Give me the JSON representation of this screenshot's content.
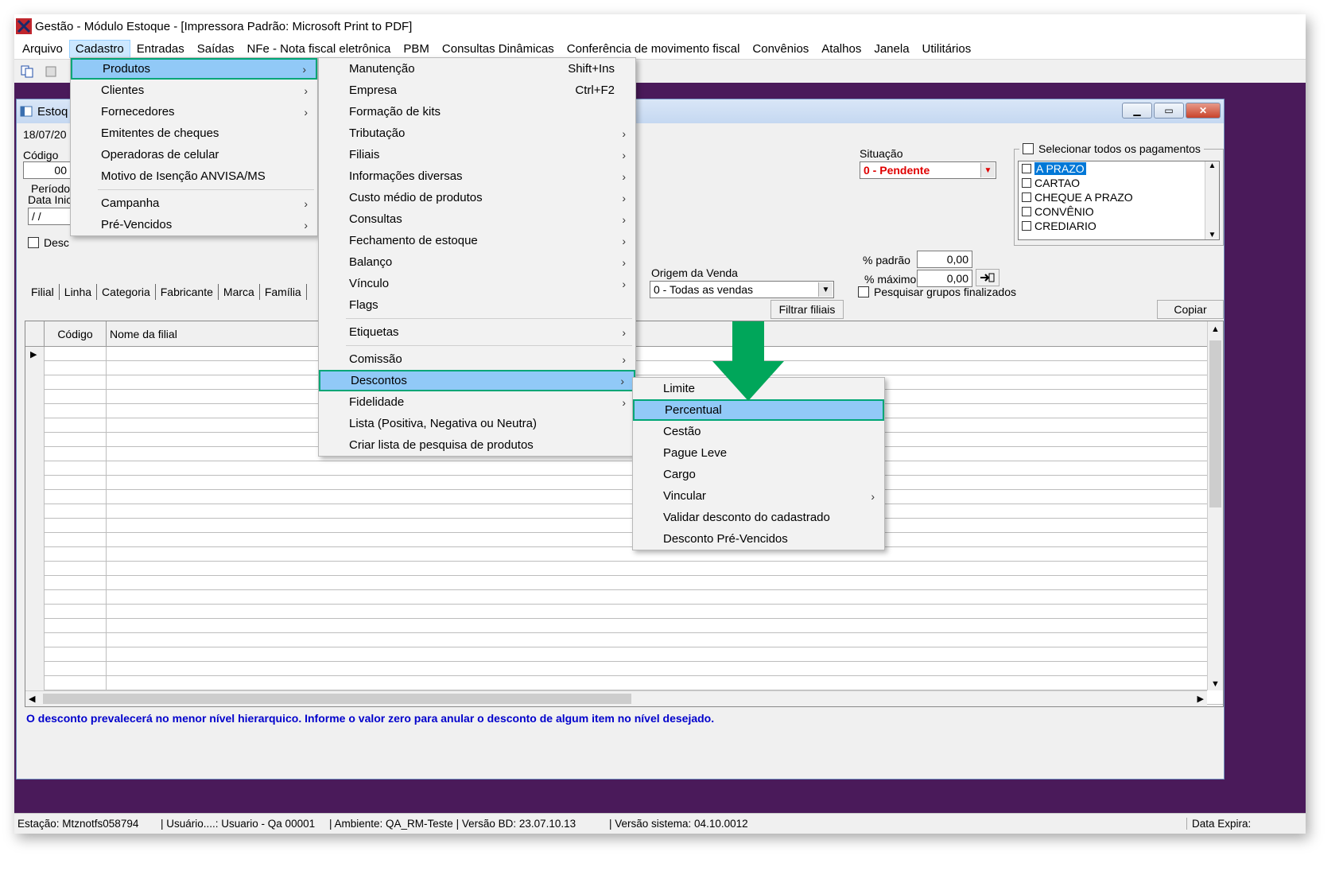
{
  "app": {
    "title": "Gestão  - Módulo Estoque - [Impressora Padrão: Microsoft Print to PDF]"
  },
  "menubar": [
    "Arquivo",
    "Cadastro",
    "Entradas",
    "Saídas",
    "NFe - Nota fiscal eletrônica",
    "PBM",
    "Consultas Dinâmicas",
    "Conferência de movimento fiscal",
    "Convênios",
    "Atalhos",
    "Janela",
    "Utilitários"
  ],
  "child": {
    "title": "Estoq",
    "date": "18/07/20",
    "codigo_label": "Código",
    "codigo_value": "00",
    "periodo_label": "Período",
    "data_inicio_label": "Data Inic",
    "data_inicio_value": "/ /",
    "desc_label": "Desc",
    "situacao_label": "Situação",
    "situacao_value": "0 - Pendente",
    "select_all_label": "Selecionar todos os pagamentos",
    "payments": [
      "A PRAZO",
      "CARTAO",
      "CHEQUE A PRAZO",
      "CONVÊNIO",
      "CREDIARIO"
    ],
    "pct_padrao_label": "% padrão",
    "pct_padrao_value": "0,00",
    "pct_maximo_label": "% máximo",
    "pct_maximo_value": "0,00",
    "origem_label": "Origem da Venda",
    "origem_value": "0 - Todas as vendas",
    "grupos_label": "Pesquisar grupos finalizados",
    "tabs": [
      "Filial",
      "Linha",
      "Categoria",
      "Fabricante",
      "Marca",
      "Família"
    ],
    "filtrar_label": "Filtrar filiais",
    "copiar_label": "Copiar",
    "grid_headers": [
      "Código",
      "Nome da filial"
    ],
    "hint": "O desconto prevalecerá no menor nível hierarquico. Informe o valor zero para anular o desconto de algum item no nível desejado."
  },
  "menu_cadastro": [
    {
      "label": "Produtos",
      "arrow": true,
      "highlight": true
    },
    {
      "label": "Clientes",
      "arrow": true
    },
    {
      "label": "Fornecedores",
      "arrow": true
    },
    {
      "label": "Emitentes de cheques"
    },
    {
      "label": "Operadoras de celular"
    },
    {
      "label": "Motivo de Isenção ANVISA/MS"
    },
    {
      "separator": true
    },
    {
      "label": "Campanha",
      "arrow": true
    },
    {
      "label": "Pré-Vencidos",
      "arrow": true
    }
  ],
  "menu_produtos": [
    {
      "label": "Manutenção",
      "shortcut": "Shift+Ins"
    },
    {
      "label": "Empresa",
      "shortcut": "Ctrl+F2"
    },
    {
      "label": "Formação de kits"
    },
    {
      "label": "Tributação",
      "arrow": true
    },
    {
      "label": "Filiais",
      "arrow": true
    },
    {
      "label": "Informações diversas",
      "arrow": true
    },
    {
      "label": "Custo médio de produtos",
      "arrow": true
    },
    {
      "label": "Consultas",
      "arrow": true
    },
    {
      "label": "Fechamento de estoque",
      "arrow": true
    },
    {
      "label": "Balanço",
      "arrow": true
    },
    {
      "label": "Vínculo",
      "arrow": true
    },
    {
      "label": "Flags"
    },
    {
      "separator": true
    },
    {
      "label": "Etiquetas",
      "arrow": true
    },
    {
      "separator": true
    },
    {
      "label": "Comissão",
      "arrow": true
    },
    {
      "label": "Descontos",
      "arrow": true,
      "highlight": true
    },
    {
      "label": "Fidelidade",
      "arrow": true
    },
    {
      "label": "Lista (Positiva, Negativa ou Neutra)"
    },
    {
      "label": "Criar lista de pesquisa de produtos"
    }
  ],
  "menu_descontos": [
    {
      "label": "Limite"
    },
    {
      "label": "Percentual",
      "highlight": true
    },
    {
      "label": "Cestão"
    },
    {
      "label": "Pague Leve"
    },
    {
      "label": "Cargo"
    },
    {
      "label": "Vincular",
      "arrow": true
    },
    {
      "label": "Validar desconto do cadastrado"
    },
    {
      "label": "Desconto Pré-Vencidos"
    }
  ],
  "statusbar": {
    "estacao": "Estação: Mtznotfs058794",
    "usuario": "| Usuário....: Usuario - Qa 00001",
    "ambiente": "| Ambiente: QA_RM-Teste | Versão BD: 23.07.10.13",
    "versao": "| Versão sistema: 04.10.0012",
    "data_expira": "Data Expira:"
  },
  "colors": {
    "highlight_fill": "#91c9f7",
    "highlight_border": "#00a676",
    "workspace": "#4a1a5a",
    "arrow": "#00a65a"
  },
  "icons": {
    "arrow_glyph": "›"
  }
}
